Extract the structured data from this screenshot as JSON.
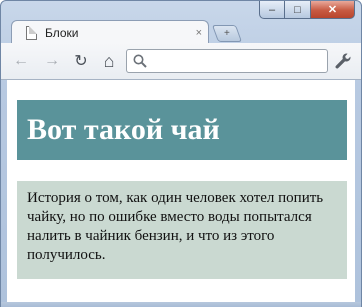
{
  "browser": {
    "tab": {
      "title": "Блоки",
      "close_symbol": "×"
    },
    "new_tab_symbol": "+",
    "window_controls": {
      "minimize": "–",
      "maximize": "□",
      "close": "✕"
    },
    "nav": {
      "back": "←",
      "forward": "→",
      "reload": "↻",
      "home": "⌂"
    },
    "omnibox": {
      "value": "",
      "placeholder": ""
    },
    "icons": {
      "page": "document-icon",
      "search": "search-icon",
      "menu": "wrench-icon"
    }
  },
  "page": {
    "heading": "Вот такой чай",
    "paragraph": "История о том, как один человек хотел попить чайку, но по ошибке вместо воды попытался налить в чайник бензин, и что из этого получилось."
  },
  "colors": {
    "heading_bg": "#5a939a",
    "text_block_bg": "#cad9d1"
  }
}
